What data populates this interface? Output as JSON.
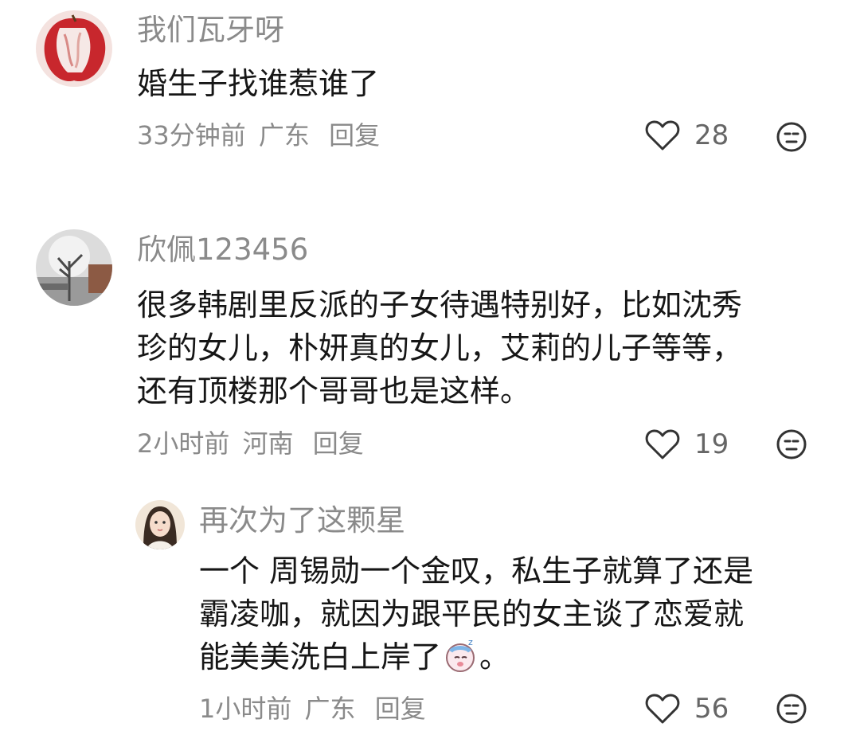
{
  "comments": [
    {
      "username": "我们瓦牙呀",
      "lines": [
        "婚生子找谁惹谁了"
      ],
      "time": "33分钟前",
      "location": "广东",
      "reply": "回复",
      "likes": "28"
    },
    {
      "username": "欣佩123456",
      "lines": [
        "很多韩剧里反派的子女待遇特别好，比如沈秀",
        "珍的女儿，朴妍真的女儿，艾莉的儿子等等，",
        "还有顶楼那个哥哥也是这样。"
      ],
      "time": "2小时前",
      "location": "河南",
      "reply": "回复",
      "likes": "19"
    },
    {
      "username": "再次为了这颗星",
      "lines": [
        "一个 周锡勋一个金叹，私生子就算了还是",
        "霸凌咖，就因为跟平民的女主谈了恋爱就",
        "能美美洗白上岸了"
      ],
      "line_end": "。",
      "time": "1小时前",
      "location": "广东",
      "reply": "回复",
      "likes": "56"
    }
  ],
  "icons": {
    "like": "heart-outline-icon",
    "reaction": "neutral-face-icon",
    "inline_emoji": "sleepy-face-emoji"
  }
}
